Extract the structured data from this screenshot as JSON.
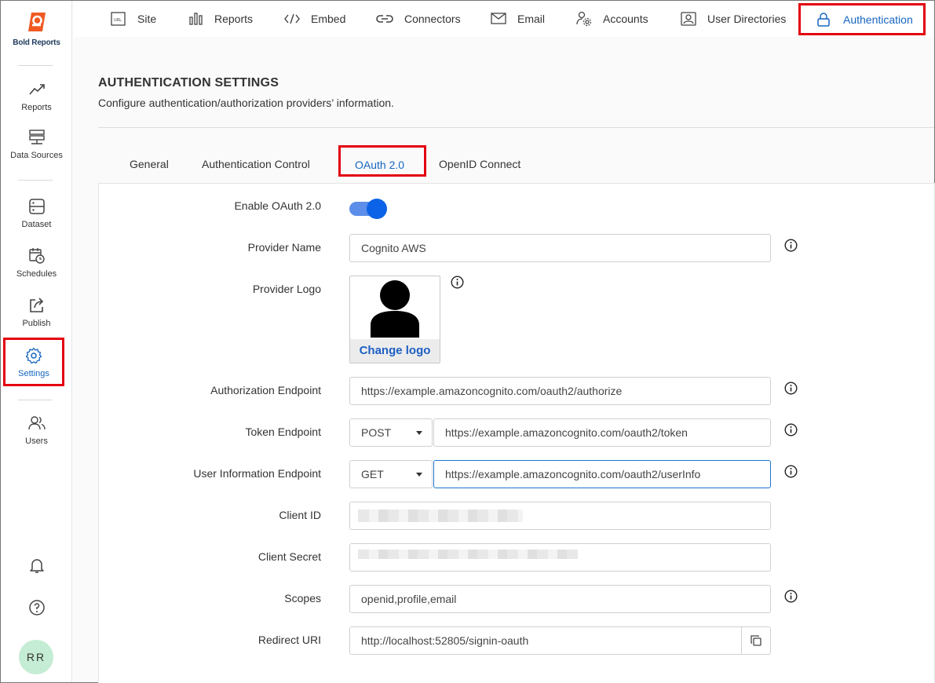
{
  "brand": {
    "name": "Bold Reports"
  },
  "sidebar": {
    "items": [
      {
        "label": "Reports",
        "icon": "trending-up-icon"
      },
      {
        "label": "Data Sources",
        "icon": "server-icon"
      },
      {
        "label": "Dataset",
        "icon": "dataset-icon"
      },
      {
        "label": "Schedules",
        "icon": "calendar-clock-icon"
      },
      {
        "label": "Publish",
        "icon": "share-icon"
      },
      {
        "label": "Settings",
        "icon": "gear-icon",
        "active": true
      },
      {
        "label": "Users",
        "icon": "users-icon"
      }
    ],
    "avatar": "RR"
  },
  "topnav": {
    "items": [
      {
        "label": "Site",
        "icon": "url-icon"
      },
      {
        "label": "Reports",
        "icon": "bar-chart-icon"
      },
      {
        "label": "Embed",
        "icon": "code-icon"
      },
      {
        "label": "Connectors",
        "icon": "link-icon"
      },
      {
        "label": "Email",
        "icon": "mail-icon"
      },
      {
        "label": "Accounts",
        "icon": "user-gear-icon"
      },
      {
        "label": "User Directories",
        "icon": "contact-card-icon"
      },
      {
        "label": "Authentication",
        "icon": "lock-icon",
        "active": true
      }
    ]
  },
  "page": {
    "title": "AUTHENTICATION SETTINGS",
    "subtitle": "Configure authentication/authorization providers’ information."
  },
  "tabs": [
    {
      "label": "General"
    },
    {
      "label": "Authentication Control"
    },
    {
      "label": "OAuth 2.0",
      "active": true
    },
    {
      "label": "OpenID Connect"
    }
  ],
  "form": {
    "enable_label": "Enable OAuth 2.0",
    "enabled": true,
    "provider_name_label": "Provider Name",
    "provider_name_value": "Cognito AWS",
    "provider_logo_label": "Provider Logo",
    "change_logo": "Change logo",
    "auth_endpoint_label": "Authorization Endpoint",
    "auth_endpoint_value": "https://example.amazoncognito.com/oauth2/authorize",
    "token_endpoint_label": "Token Endpoint",
    "token_method": "POST",
    "token_endpoint_value": "https://example.amazoncognito.com/oauth2/token",
    "userinfo_endpoint_label": "User Information Endpoint",
    "userinfo_method": "GET",
    "userinfo_endpoint_value": "https://example.amazoncognito.com/oauth2/userInfo",
    "client_id_label": "Client ID",
    "client_secret_label": "Client Secret",
    "scopes_label": "Scopes",
    "scopes_value": "openid,profile,email",
    "redirect_label": "Redirect URI",
    "redirect_value": "http://localhost:52805/signin-oauth"
  },
  "colors": {
    "accent": "#1565c0",
    "highlight": "#e3000f",
    "toggle": "#0d63e8"
  }
}
